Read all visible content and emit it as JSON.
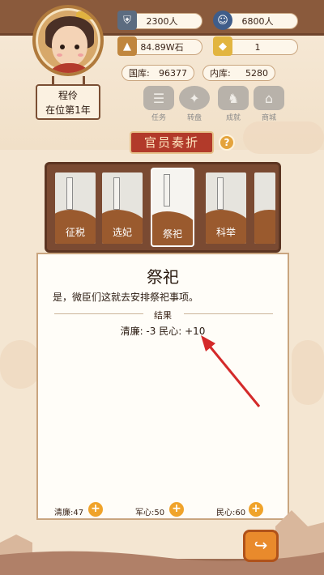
{
  "header": {
    "population_1": "2300人",
    "population_2": "6800人",
    "grain": "84.89W石",
    "count": "1",
    "treasury_label": "国库:",
    "treasury_value": "96377",
    "inner_treasury_label": "内库:",
    "inner_treasury_value": "5280"
  },
  "player": {
    "name": "程伶",
    "reign": "在位第1年"
  },
  "menu": [
    {
      "label": "任务",
      "icon": "task-icon"
    },
    {
      "label": "转盘",
      "icon": "wheel-icon"
    },
    {
      "label": "成就",
      "icon": "achievement-icon"
    },
    {
      "label": "商城",
      "icon": "shop-icon"
    }
  ],
  "section": {
    "title": "官员奏折",
    "help": "?"
  },
  "categories": [
    {
      "label": "征税"
    },
    {
      "label": "选妃"
    },
    {
      "label": "祭祀",
      "active": true
    },
    {
      "label": "科举"
    }
  ],
  "content": {
    "title": "祭祀",
    "message": "是，微臣们这就去安排祭祀事项。",
    "result_label": "结果",
    "result_text": "清廉: -3  民心: +10"
  },
  "footer_stats": [
    {
      "label": "清廉:47"
    },
    {
      "label": "军心:50"
    },
    {
      "label": "民心:60"
    }
  ],
  "colors": {
    "accent_red": "#b23a2a",
    "brown": "#7a4a32",
    "orange": "#f0a32a",
    "annotation_arrow": "#d42a2a"
  }
}
